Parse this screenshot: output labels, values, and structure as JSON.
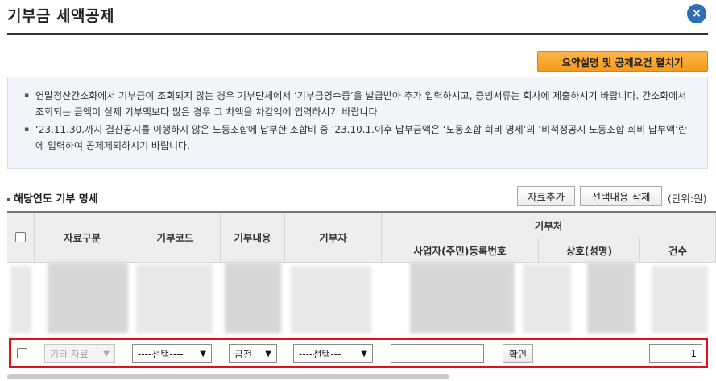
{
  "dialog": {
    "title": "기부금 세액공제",
    "close_icon": "×"
  },
  "summary_button": "요약설명 및 공제요건 펼치기",
  "notice": [
    "연말정산간소화에서 기부금이 조회되지 않는 경우 기부단체에서 ‘기부금영수증’을 발급받아 추가 입력하시고, 증빙서류는 회사에 제출하시기 바랍니다. 간소화에서 조회되는 금액이 실제 기부액보다 많은 경우 그 차액을 차감액에 입력하시기 바랍니다.",
    "‘23.11.30.까지 결산공시를 이행하지 않은 노동조합에 납부한 조합비 중 ‘23.10.1.이후 납부금액은 ‘노동조합 회비 명세’의 ‘비적정공시 노동조합 회비 납부액’란에 입력하여 공제제외하시기 바랍니다."
  ],
  "section": {
    "title": "해당연도 기부 명세",
    "add_button": "자료추가",
    "delete_button": "선택내용 삭제",
    "unit": "(단위:원)"
  },
  "table": {
    "headers": {
      "data_type": "자료구분",
      "donation_code": "기부코드",
      "donation_content": "기부내용",
      "donor": "기부자",
      "recipient": "기부처",
      "business_number": "사업자(주민)등록번호",
      "business_name": "상호(성명)",
      "count": "건수"
    }
  },
  "new_row": {
    "data_type": "기타 자료",
    "donation_code": "----선택----",
    "donation_content": "금전",
    "donor": "----선택---",
    "business_number": "",
    "confirm_button": "확인",
    "count": "1"
  },
  "colors": {
    "accent": "#2f6db5",
    "highlight": "#e0101a",
    "summary_button": "#f59a1d"
  }
}
